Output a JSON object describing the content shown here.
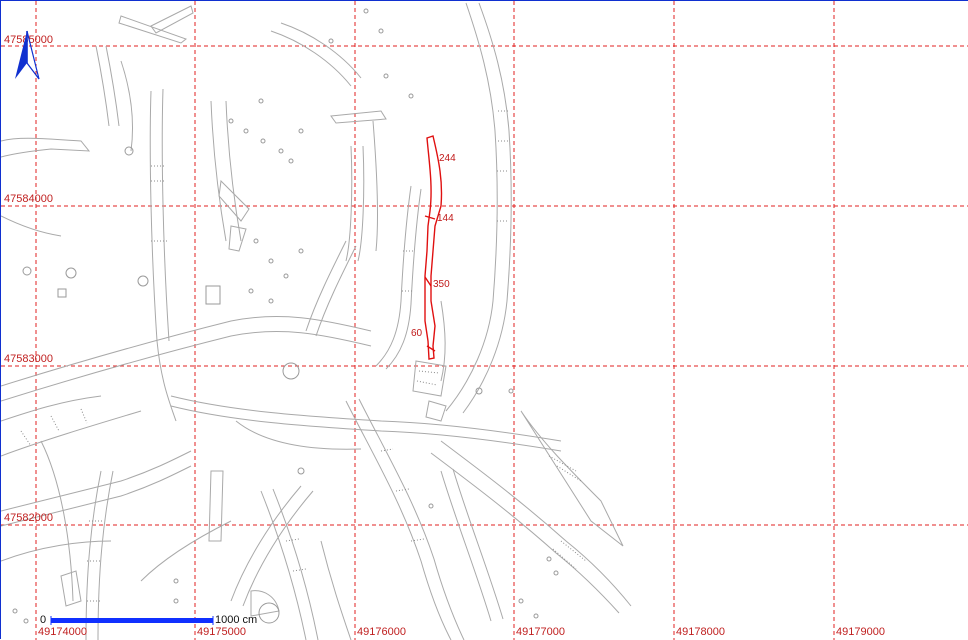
{
  "map": {
    "x_labels": [
      "49174000",
      "49175000",
      "49176000",
      "49177000",
      "49178000",
      "49179000"
    ],
    "y_labels": [
      "4758000",
      "4758000",
      "4758000",
      "4758000"
    ],
    "y_labels_exact": [
      "47585000",
      "47584000",
      "47583000",
      "47582000"
    ],
    "highlighted_segments": [
      "244",
      "144",
      "350",
      "60"
    ],
    "scale_bar": {
      "start": "0",
      "end": "1000 cm"
    },
    "colors": {
      "grid": "#e02020",
      "highlight": "#e01010",
      "features": "#a9a9a9",
      "north_arrow": "#1030d0",
      "scale_bar": "#1030ff"
    },
    "north_arrow": "north-arrow-icon"
  }
}
